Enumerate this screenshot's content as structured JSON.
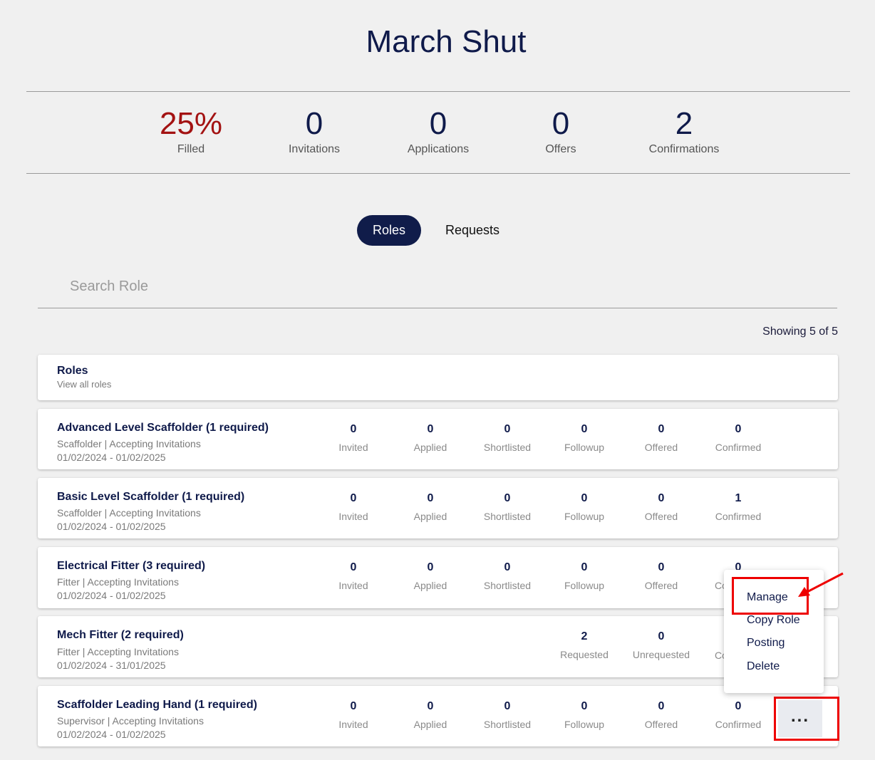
{
  "page": {
    "title": "March Shut"
  },
  "stats": [
    {
      "value": "25%",
      "label": "Filled"
    },
    {
      "value": "0",
      "label": "Invitations"
    },
    {
      "value": "0",
      "label": "Applications"
    },
    {
      "value": "0",
      "label": "Offers"
    },
    {
      "value": "2",
      "label": "Confirmations"
    }
  ],
  "tabs": {
    "roles": "Roles",
    "requests": "Requests"
  },
  "search": {
    "placeholder": "Search Role"
  },
  "showing": "Showing 5 of 5",
  "roles_header": {
    "title": "Roles",
    "subtitle": "View all roles"
  },
  "metric_labels": {
    "invited": "Invited",
    "applied": "Applied",
    "shortlisted": "Shortlisted",
    "followup": "Followup",
    "offered": "Offered",
    "confirmed": "Confirmed",
    "requested": "Requested",
    "unrequested": "Unrequested"
  },
  "roles": [
    {
      "title": "Advanced Level Scaffolder (1 required)",
      "sub": "Scaffolder | Accepting Invitations",
      "date": "01/02/2024 - 01/02/2025",
      "values": [
        "0",
        "0",
        "0",
        "0",
        "0",
        "0"
      ]
    },
    {
      "title": "Basic Level Scaffolder (1 required)",
      "sub": "Scaffolder | Accepting Invitations",
      "date": "01/02/2024 - 01/02/2025",
      "values": [
        "0",
        "0",
        "0",
        "0",
        "0",
        "1"
      ]
    },
    {
      "title": "Electrical Fitter (3 required)",
      "sub": "Fitter | Accepting Invitations",
      "date": "01/02/2024 - 01/02/2025",
      "values": [
        "0",
        "0",
        "0",
        "0",
        "0",
        "0"
      ],
      "partial_label": "Co"
    },
    {
      "title": "Mech Fitter (2 required)",
      "sub": "Fitter | Accepting Invitations",
      "date": "01/02/2024 - 31/01/2025",
      "values": [
        "2",
        "0"
      ],
      "partial_label": "Co"
    },
    {
      "title": "Scaffolder Leading Hand (1 required)",
      "sub": "Supervisor | Accepting Invitations",
      "date": "01/02/2024 - 01/02/2025",
      "values": [
        "0",
        "0",
        "0",
        "0",
        "0",
        "0"
      ]
    }
  ],
  "menu": {
    "items": [
      "Manage",
      "Copy Role",
      "Posting",
      "Delete"
    ]
  },
  "more_button": "...",
  "colors": {
    "accent": "#101c4a",
    "filled": "#a31212",
    "highlight": "#e00000"
  }
}
